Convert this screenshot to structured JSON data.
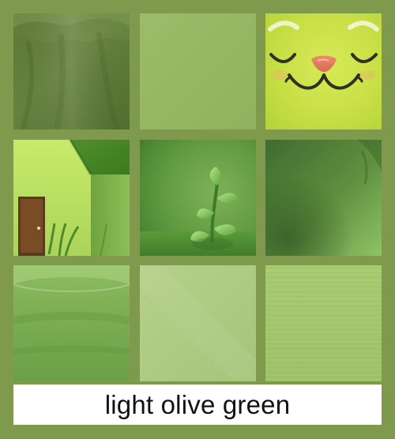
{
  "caption": {
    "text": "light olive green"
  },
  "colors": {
    "frame": "#7f9a4d",
    "caption_background": "#ffffff",
    "caption_text": "#111111"
  },
  "tiles": [
    {
      "name": "draped-fabric-tile",
      "icon": "fabric-image"
    },
    {
      "name": "solid-swatch-tile",
      "icon": "swatch-image"
    },
    {
      "name": "cat-face-tile",
      "icon": "cat-face-image"
    },
    {
      "name": "house-tile",
      "icon": "house-image"
    },
    {
      "name": "plant-tile",
      "icon": "plant-image"
    },
    {
      "name": "green-gradient-tile",
      "icon": "gradient-image"
    },
    {
      "name": "rounded-surface-tile",
      "icon": "bowl-surface-image"
    },
    {
      "name": "light-swatch-tile",
      "icon": "swatch-image"
    },
    {
      "name": "textured-swatch-tile",
      "icon": "texture-image"
    }
  ]
}
